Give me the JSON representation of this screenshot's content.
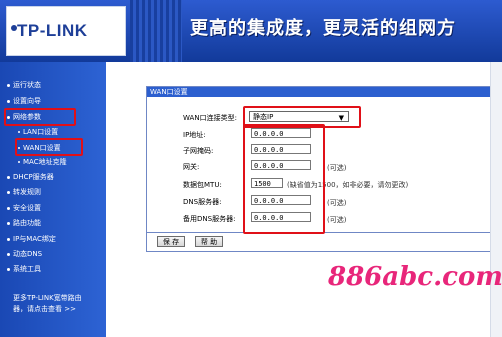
{
  "header": {
    "logo_text": "TP-LINK",
    "slogan": "更高的集成度，更灵活的组网方"
  },
  "sidebar": {
    "items": [
      {
        "label": "运行状态"
      },
      {
        "label": "设置向导"
      },
      {
        "label": "网络参数"
      },
      {
        "label": "LAN口设置"
      },
      {
        "label": "WAN口设置"
      },
      {
        "label": "MAC地址克隆"
      },
      {
        "label": "DHCP服务器"
      },
      {
        "label": "转发规则"
      },
      {
        "label": "安全设置"
      },
      {
        "label": "路由功能"
      },
      {
        "label": "IP与MAC绑定"
      },
      {
        "label": "动态DNS"
      },
      {
        "label": "系统工具"
      }
    ],
    "promo_line1": "更多TP-LINK宽带路由",
    "promo_line2": "器，请点击查看 >>"
  },
  "panel": {
    "title": "WAN口设置",
    "connection_type_label": "WAN口连接类型:",
    "connection_type_value": "静态IP",
    "ip_label": "IP地址:",
    "ip_value": "0.0.0.0",
    "mask_label": "子网掩码:",
    "mask_value": "0.0.0.0",
    "gateway_label": "网关:",
    "gateway_value": "0.0.0.0",
    "gateway_hint": "(可选)",
    "mtu_label": "数据包MTU:",
    "mtu_value": "1500",
    "mtu_hint": "(缺省值为1500，如非必要，请勿更改)",
    "dns_label": "DNS服务器:",
    "dns_value": "0.0.0.0",
    "dns_hint": "(可选)",
    "dns2_label": "备用DNS服务器:",
    "dns2_value": "0.0.0.0",
    "dns2_hint": "(可选)",
    "save_label": "保 存",
    "help_label": "帮 助"
  },
  "watermark": "886abc.com",
  "colors": {
    "header_blue": "#1e47b0",
    "sidebar_blue": "#2558c8",
    "highlight_red": "#e01018",
    "watermark_pink": "#e8267a"
  }
}
